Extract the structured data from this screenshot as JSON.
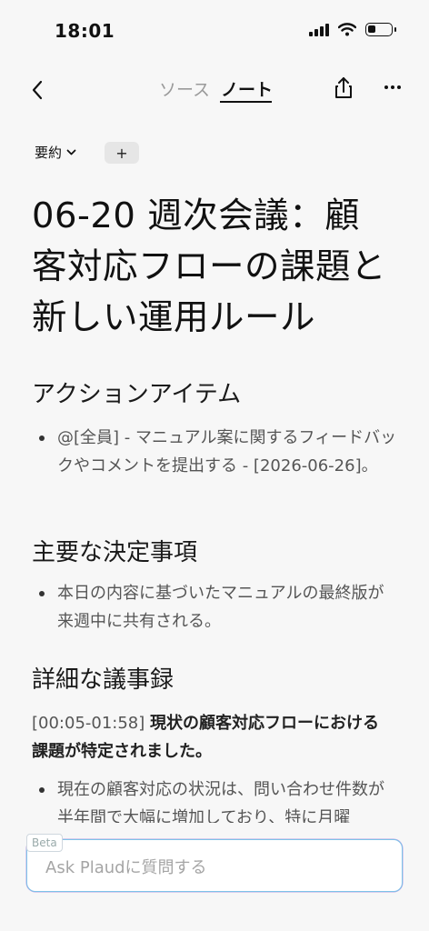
{
  "status_bar": {
    "time": "18:01"
  },
  "nav": {
    "tabs": [
      {
        "label": "ソース",
        "active": false
      },
      {
        "label": "ノート",
        "active": true
      }
    ]
  },
  "controls": {
    "summary_label": "要約",
    "add_label": "+"
  },
  "note": {
    "title": "06-20 週次会議：顧客対応フローの課題と新しい運用ルール",
    "sections": [
      {
        "heading": "アクションアイテム",
        "items": [
          "@[全員] - マニュアル案に関するフィードバックやコメントを提出する - [2026-06-26]。"
        ]
      },
      {
        "heading": "主要な決定事項",
        "items": [
          "本日の内容に基づいたマニュアルの最終版が来週中に共有される。"
        ]
      },
      {
        "heading": "詳細な議事録",
        "timestamp": "[00:05-01:58]",
        "bold": "現状の顧客対応フローにおける課題が特定されました。",
        "items": [
          "現在の顧客対応の状況は、問い合わせ件数が半年間で大幅に増加しており、特に月曜"
        ]
      }
    ]
  },
  "ask_bar": {
    "badge": "Beta",
    "placeholder": "Ask Plaudに質問する"
  },
  "colors": {
    "accent_border": "#7ec2e8",
    "text": "#1a1a1a",
    "muted": "#9a9a9a"
  }
}
